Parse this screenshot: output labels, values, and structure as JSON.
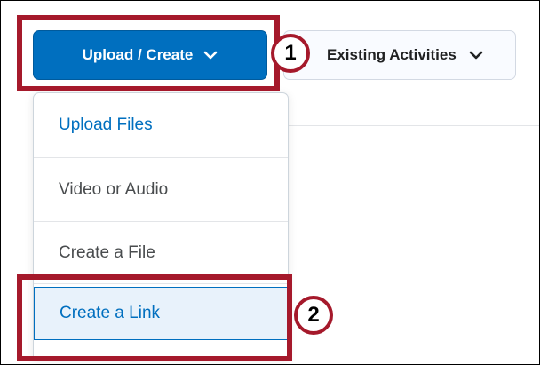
{
  "toolbar": {
    "upload_create_label": "Upload / Create",
    "existing_activities_label": "Existing Activities"
  },
  "menu": {
    "items": [
      {
        "label": "Upload Files"
      },
      {
        "label": "Video or Audio"
      },
      {
        "label": "Create a File"
      },
      {
        "label": "Create a Link"
      }
    ]
  },
  "callouts": {
    "step1": "1",
    "step2": "2"
  },
  "colors": {
    "primary": "#006fbf",
    "highlight": "#a5192b",
    "selected_bg": "#e8f2fb"
  },
  "icons": {
    "dropdown": "chevron-down-icon"
  }
}
